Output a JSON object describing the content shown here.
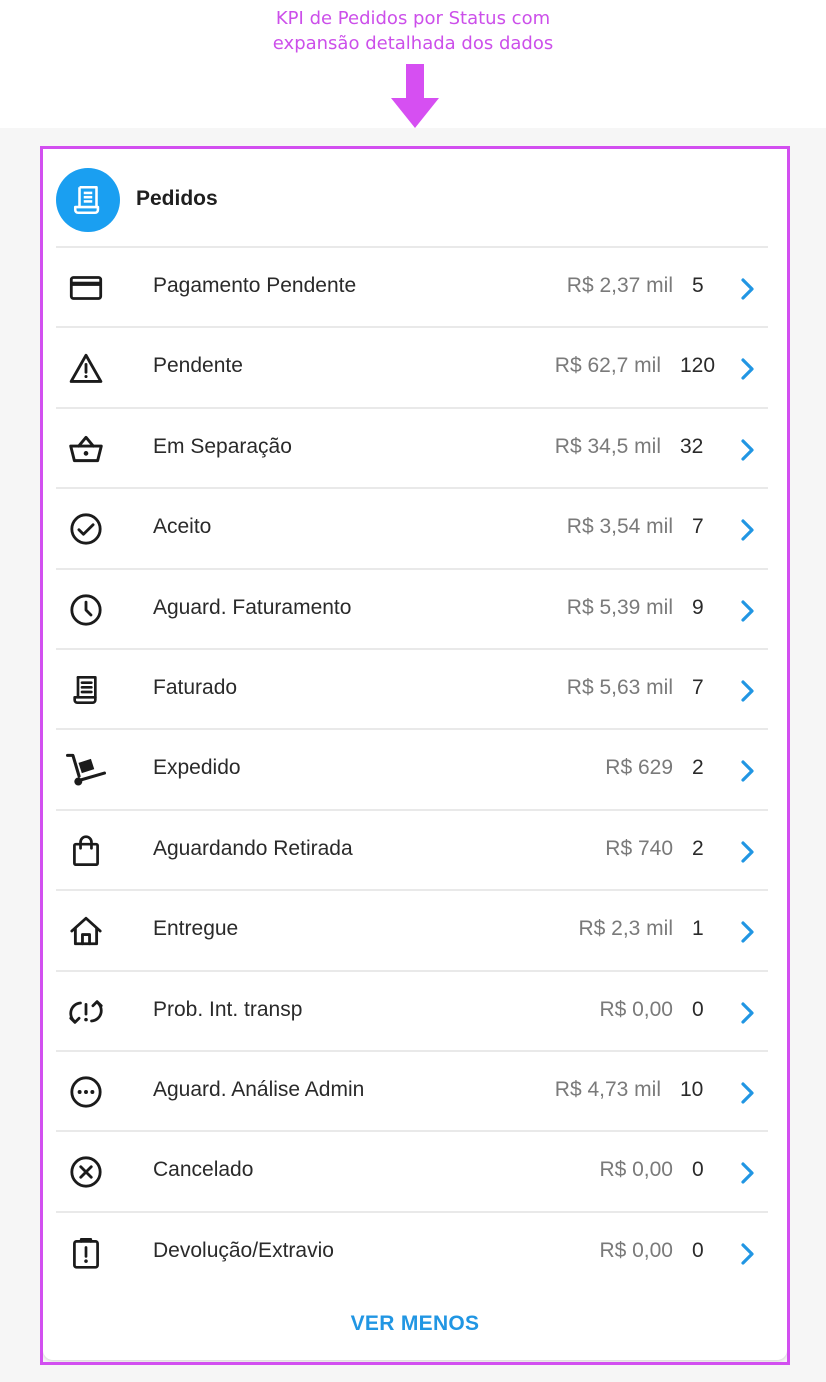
{
  "annotation": {
    "line1": "KPI de Pedidos por Status com",
    "line2": "expansão detalhada dos dados"
  },
  "colors": {
    "annotation": "#cc4fea",
    "accent": "#1a9ff1",
    "highlight_border": "#d24ff0"
  },
  "header": {
    "icon": "receipt-icon",
    "title": "Pedidos"
  },
  "rows": [
    {
      "icon": "credit-card-icon",
      "label": "Pagamento Pendente",
      "value": "R$ 2,37 mil",
      "count": "5"
    },
    {
      "icon": "warning-icon",
      "label": "Pendente",
      "value": "R$ 62,7 mil",
      "count": "120"
    },
    {
      "icon": "basket-icon",
      "label": "Em Separação",
      "value": "R$ 34,5 mil",
      "count": "32"
    },
    {
      "icon": "check-circle-icon",
      "label": "Aceito",
      "value": "R$ 3,54 mil",
      "count": "7"
    },
    {
      "icon": "clock-icon",
      "label": "Aguard. Faturamento",
      "value": "R$ 5,39 mil",
      "count": "9"
    },
    {
      "icon": "receipt-icon",
      "label": "Faturado",
      "value": "R$ 5,63 mil",
      "count": "7"
    },
    {
      "icon": "hand-truck-icon",
      "label": "Expedido",
      "value": "R$ 629",
      "count": "2"
    },
    {
      "icon": "shopping-bag-icon",
      "label": "Aguardando Retirada",
      "value": "R$ 740",
      "count": "2"
    },
    {
      "icon": "home-icon",
      "label": "Entregue",
      "value": "R$ 2,3 mil",
      "count": "1"
    },
    {
      "icon": "sync-problem-icon",
      "label": "Prob. Int. transp",
      "value": "R$ 0,00",
      "count": "0"
    },
    {
      "icon": "more-circle-icon",
      "label": "Aguard. Análise Admin",
      "value": "R$ 4,73 mil",
      "count": "10"
    },
    {
      "icon": "cancel-circle-icon",
      "label": "Cancelado",
      "value": "R$ 0,00",
      "count": "0"
    },
    {
      "icon": "clipboard-alert-icon",
      "label": "Devolução/Extravio",
      "value": "R$ 0,00",
      "count": "0"
    }
  ],
  "footer": {
    "toggle_label": "VER MENOS"
  }
}
